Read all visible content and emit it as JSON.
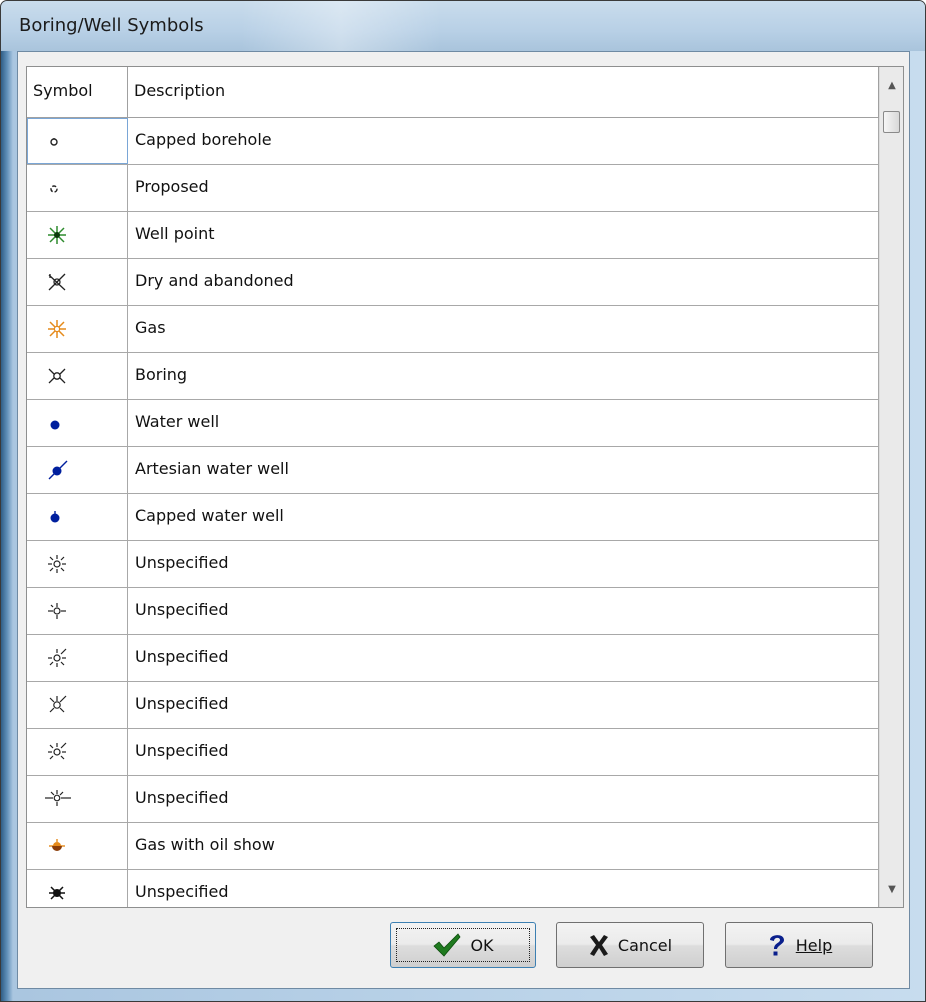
{
  "window": {
    "title": "Boring/Well Symbols"
  },
  "grid": {
    "columns": [
      "Symbol",
      "Description"
    ],
    "rows": [
      {
        "symbol_icon": "capped-borehole-icon",
        "description": "Capped borehole"
      },
      {
        "symbol_icon": "proposed-icon",
        "description": "Proposed"
      },
      {
        "symbol_icon": "well-point-icon",
        "description": "Well point"
      },
      {
        "symbol_icon": "dry-abandoned-icon",
        "description": "Dry and abandoned"
      },
      {
        "symbol_icon": "gas-icon",
        "description": "Gas"
      },
      {
        "symbol_icon": "boring-icon",
        "description": "Boring"
      },
      {
        "symbol_icon": "water-well-icon",
        "description": "Water well"
      },
      {
        "symbol_icon": "artesian-water-well-icon",
        "description": "Artesian water well"
      },
      {
        "symbol_icon": "capped-water-well-icon",
        "description": "Capped water well"
      },
      {
        "symbol_icon": "unspecified-1-icon",
        "description": "Unspecified"
      },
      {
        "symbol_icon": "unspecified-2-icon",
        "description": "Unspecified"
      },
      {
        "symbol_icon": "unspecified-3-icon",
        "description": "Unspecified"
      },
      {
        "symbol_icon": "unspecified-4-icon",
        "description": "Unspecified"
      },
      {
        "symbol_icon": "unspecified-5-icon",
        "description": "Unspecified"
      },
      {
        "symbol_icon": "unspecified-6-icon",
        "description": "Unspecified"
      },
      {
        "symbol_icon": "gas-with-oil-show-icon",
        "description": "Gas with oil show"
      },
      {
        "symbol_icon": "unspecified-7-icon",
        "description": "Unspecified"
      }
    ]
  },
  "buttons": {
    "ok_label": "OK",
    "cancel_label": "Cancel",
    "help_label": "Help"
  },
  "colors": {
    "blue_symbol": "#001f9e",
    "green_symbol": "#2e8b2e",
    "orange_symbol": "#e58a1a",
    "brown_symbol": "#8a3c08"
  }
}
